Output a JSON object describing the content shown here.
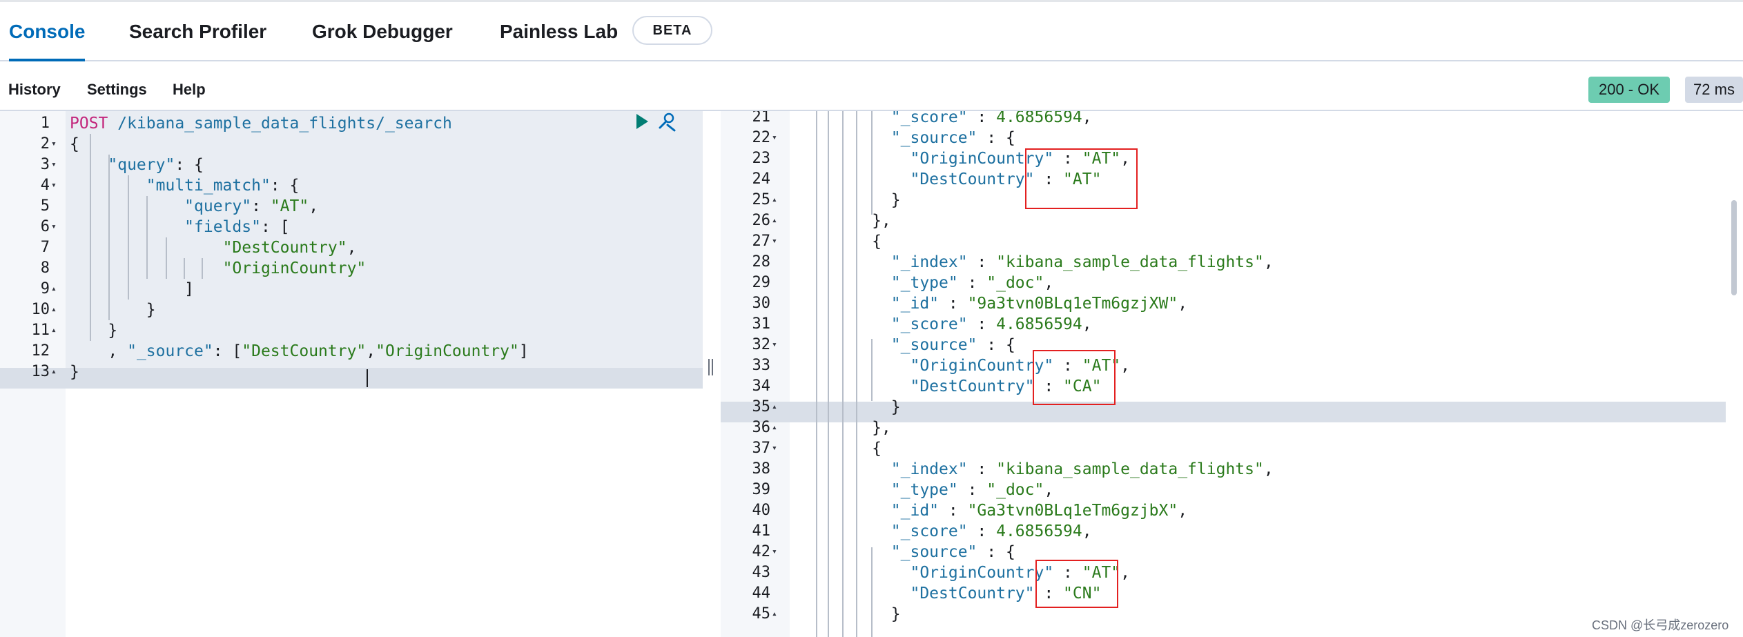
{
  "tabs": [
    {
      "label": "Console",
      "active": true
    },
    {
      "label": "Search Profiler"
    },
    {
      "label": "Grok Debugger"
    },
    {
      "label": "Painless Lab"
    }
  ],
  "beta_badge": "BETA",
  "toolbar": {
    "history": "History",
    "settings": "Settings",
    "help": "Help"
  },
  "response": {
    "status": "200 - OK",
    "time": "72 ms"
  },
  "colors": {
    "accent": "#006bb8",
    "status_ok": "#6dccb1",
    "highlight_box": "#e32020"
  },
  "request_editor": {
    "lines": [
      {
        "n": "1",
        "fold": "",
        "text": "POST /kibana_sample_data_flights/_search"
      },
      {
        "n": "2",
        "fold": "▾",
        "text": "{"
      },
      {
        "n": "3",
        "fold": "▾",
        "text": "    \"query\": {"
      },
      {
        "n": "4",
        "fold": "▾",
        "text": "        \"multi_match\": {"
      },
      {
        "n": "5",
        "fold": "",
        "text": "            \"query\": \"AT\","
      },
      {
        "n": "6",
        "fold": "▾",
        "text": "            \"fields\": ["
      },
      {
        "n": "7",
        "fold": "",
        "text": "                \"DestCountry\","
      },
      {
        "n": "8",
        "fold": "",
        "text": "                \"OriginCountry\""
      },
      {
        "n": "9",
        "fold": "▴",
        "text": "            ]"
      },
      {
        "n": "10",
        "fold": "▴",
        "text": "        }"
      },
      {
        "n": "11",
        "fold": "▴",
        "text": "    }"
      },
      {
        "n": "12",
        "fold": "",
        "text": "    , \"_source\": [\"DestCountry\",\"OriginCountry\"]"
      },
      {
        "n": "13",
        "fold": "▴",
        "text": "}"
      }
    ]
  },
  "response_editor": {
    "lines": [
      {
        "n": "21",
        "fold": "",
        "text": "        \"_score\" : 4.6856594,"
      },
      {
        "n": "22",
        "fold": "▾",
        "text": "        \"_source\" : {"
      },
      {
        "n": "23",
        "fold": "",
        "text": "          \"OriginCountry\" : \"AT\","
      },
      {
        "n": "24",
        "fold": "",
        "text": "          \"DestCountry\" : \"AT\""
      },
      {
        "n": "25",
        "fold": "▴",
        "text": "        }"
      },
      {
        "n": "26",
        "fold": "▴",
        "text": "      },"
      },
      {
        "n": "27",
        "fold": "▾",
        "text": "      {"
      },
      {
        "n": "28",
        "fold": "",
        "text": "        \"_index\" : \"kibana_sample_data_flights\","
      },
      {
        "n": "29",
        "fold": "",
        "text": "        \"_type\" : \"_doc\","
      },
      {
        "n": "30",
        "fold": "",
        "text": "        \"_id\" : \"9a3tvn0BLq1eTm6gzjXW\","
      },
      {
        "n": "31",
        "fold": "",
        "text": "        \"_score\" : 4.6856594,"
      },
      {
        "n": "32",
        "fold": "▾",
        "text": "        \"_source\" : {"
      },
      {
        "n": "33",
        "fold": "",
        "text": "          \"OriginCountry\" : \"AT\","
      },
      {
        "n": "34",
        "fold": "",
        "text": "          \"DestCountry\" : \"CA\""
      },
      {
        "n": "35",
        "fold": "▴",
        "text": "        }"
      },
      {
        "n": "36",
        "fold": "▴",
        "text": "      },"
      },
      {
        "n": "37",
        "fold": "▾",
        "text": "      {"
      },
      {
        "n": "38",
        "fold": "",
        "text": "        \"_index\" : \"kibana_sample_data_flights\","
      },
      {
        "n": "39",
        "fold": "",
        "text": "        \"_type\" : \"_doc\","
      },
      {
        "n": "40",
        "fold": "",
        "text": "        \"_id\" : \"Ga3tvn0BLq1eTm6gzjbX\","
      },
      {
        "n": "41",
        "fold": "",
        "text": "        \"_score\" : 4.6856594,"
      },
      {
        "n": "42",
        "fold": "▾",
        "text": "        \"_source\" : {"
      },
      {
        "n": "43",
        "fold": "",
        "text": "          \"OriginCountry\" : \"AT\","
      },
      {
        "n": "44",
        "fold": "",
        "text": "          \"DestCountry\" : \"CN\""
      },
      {
        "n": "45",
        "fold": "▴",
        "text": "        }"
      }
    ]
  },
  "watermark": "CSDN @长弓成zerozero"
}
